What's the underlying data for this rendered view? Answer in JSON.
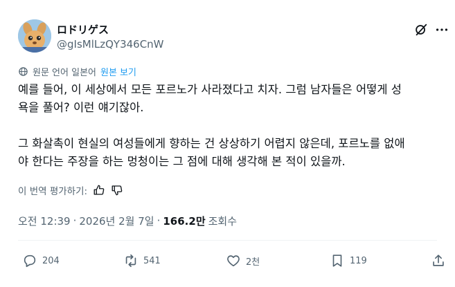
{
  "author": {
    "display_name": "ロドリゲス",
    "handle": "@gIsMlLzQY346CnW"
  },
  "translation": {
    "source_label": "원문 언어 일본어",
    "show_original_label": "원본 보기"
  },
  "post": {
    "paragraph1_line1": "예를 들어, 이 세상에서 모든 포르노가 사라졌다고 치자. 그럼 남자들은 어떻게 성",
    "paragraph1_line2": "욕을 풀어? 이런 얘기잖아.",
    "paragraph2_line1": "그 화살촉이 현실의 여성들에게 향하는 건 상상하기 어렵지 않은데, 포르노를 없애",
    "paragraph2_line2": "야 한다는 주장을 하는 멍청이는 그 점에 대해 생각해 본 적이 있을까."
  },
  "rating": {
    "label": "이 번역 평가하기:"
  },
  "meta": {
    "time": "오전 12:39",
    "separator": "·",
    "date": "2026년 2월 7일",
    "views_count": "166.2만",
    "views_label": "조회수"
  },
  "actions": {
    "replies": "204",
    "reposts": "541",
    "likes": "2천",
    "bookmarks": "119"
  },
  "icons": {
    "top_left": "grok-slash-icon",
    "top_right": "more-icon",
    "translate": "globe-icon",
    "reply": "reply-icon",
    "repost": "repost-icon",
    "like": "heart-icon",
    "bookmark": "bookmark-icon",
    "share": "share-icon"
  },
  "colors": {
    "text_primary": "#0f1419",
    "text_secondary": "#536471",
    "link": "#1d9bf0",
    "divider": "#eff3f4"
  }
}
